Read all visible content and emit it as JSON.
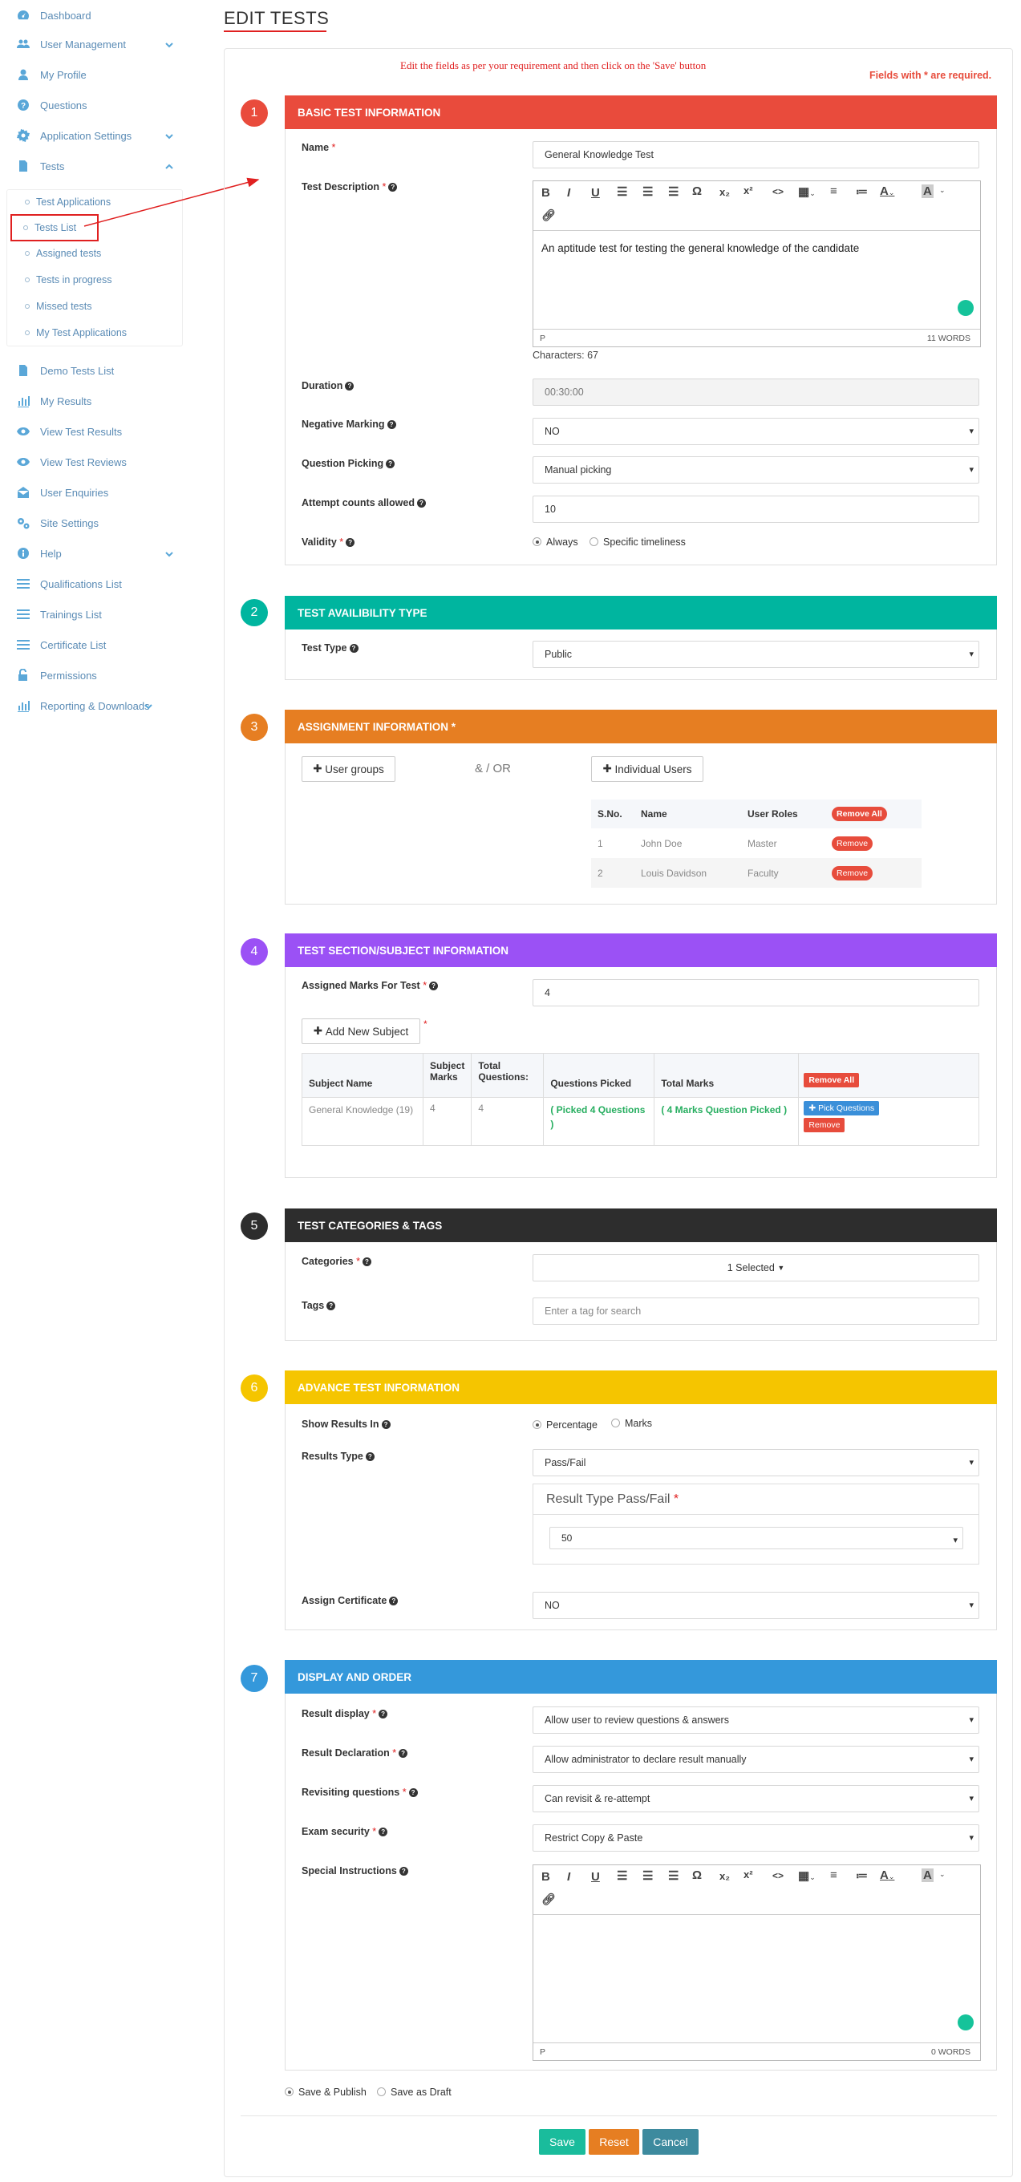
{
  "sidebar": {
    "items": [
      {
        "label": "Dashboard",
        "icon": "dashboard-icon"
      },
      {
        "label": "User Management",
        "icon": "users-icon"
      },
      {
        "label": "My Profile",
        "icon": "user-icon"
      },
      {
        "label": "Questions",
        "icon": "question-icon"
      },
      {
        "label": "Application Settings",
        "icon": "gear-icon"
      },
      {
        "label": "Tests",
        "icon": "file-icon"
      },
      {
        "label": "Demo Tests List",
        "icon": "file-icon"
      },
      {
        "label": "My Results",
        "icon": "bar-chart-icon"
      },
      {
        "label": "View Test Results",
        "icon": "eye-icon"
      },
      {
        "label": "View Test Reviews",
        "icon": "eye-icon"
      },
      {
        "label": "User Enquiries",
        "icon": "envelope-icon"
      },
      {
        "label": "Site Settings",
        "icon": "gears-icon"
      },
      {
        "label": "Help",
        "icon": "info-icon"
      },
      {
        "label": "Qualifications List",
        "icon": "list-icon"
      },
      {
        "label": "Trainings List",
        "icon": "list-icon"
      },
      {
        "label": "Certificate List",
        "icon": "list-icon"
      },
      {
        "label": "Permissions",
        "icon": "unlock-icon"
      },
      {
        "label": "Reporting & Downloads",
        "icon": "bar-chart-icon"
      }
    ],
    "sub_items": [
      "Test Applications",
      "Tests List",
      "Assigned tests",
      "Tests in progress",
      "Missed tests",
      "My Test Applications"
    ]
  },
  "page": {
    "title": "EDIT TESTS",
    "instruction": "Edit the fields as per your requirement and then click on the 'Save' button",
    "required_note": "Fields with * are required."
  },
  "s1": {
    "num": "1",
    "title": "BASIC TEST INFORMATION",
    "name_label": "Name",
    "name_value": "General Knowledge Test",
    "desc_label": "Test Description",
    "desc_text": "An aptitude test for testing the general knowledge of the candidate",
    "editor_path": "P",
    "word_count": "11 WORDS",
    "char_count": "Characters: 67",
    "duration_label": "Duration",
    "duration_value": "00:30:00",
    "neg_label": "Negative Marking",
    "neg_value": "NO",
    "pick_label": "Question Picking",
    "pick_value": "Manual picking",
    "attempt_label": "Attempt counts allowed",
    "attempt_value": "10",
    "validity_label": "Validity",
    "validity_opt1": "Always",
    "validity_opt2": "Specific timeliness"
  },
  "s2": {
    "num": "2",
    "title": "TEST AVAILIBILITY TYPE",
    "type_label": "Test Type",
    "type_value": "Public"
  },
  "s3": {
    "num": "3",
    "title": "ASSIGNMENT INFORMATION *",
    "user_groups": "User groups",
    "and_or": "& / OR",
    "individual": "Individual Users",
    "headers": [
      "S.No.",
      "Name",
      "User Roles"
    ],
    "remove_all": "Remove All",
    "remove": "Remove",
    "rows": [
      {
        "sno": "1",
        "name": "John Doe",
        "role": "Master"
      },
      {
        "sno": "2",
        "name": "Louis Davidson",
        "role": "Faculty"
      }
    ]
  },
  "s4": {
    "num": "4",
    "title": "TEST SECTION/SUBJECT INFORMATION",
    "marks_label": "Assigned Marks For Test",
    "marks_value": "4",
    "add_subject": "Add New Subject",
    "headers": [
      "Subject Name",
      "Subject Marks",
      "Total Questions:",
      "Questions Picked",
      "Total Marks"
    ],
    "remove_all": "Remove All",
    "row": {
      "name": "General Knowledge (19)",
      "marks": "4",
      "total": "4",
      "picked": "( Picked 4 Questions )",
      "total_marks": "( 4 Marks Question Picked )"
    },
    "pick_btn": "Pick Questions",
    "remove_btn": "Remove"
  },
  "s5": {
    "num": "5",
    "title": "TEST CATEGORIES & TAGS",
    "cat_label": "Categories",
    "cat_value": "1 Selected",
    "tags_label": "Tags",
    "tags_placeholder": "Enter a tag for search"
  },
  "s6": {
    "num": "6",
    "title": "ADVANCE TEST INFORMATION",
    "show_label": "Show Results In",
    "opt1": "Percentage",
    "opt2": "Marks",
    "rtype_label": "Results Type",
    "rtype_value": "Pass/Fail",
    "sub_title": "Result Type Pass/Fail",
    "sub_value": "50",
    "cert_label": "Assign Certificate",
    "cert_value": "NO"
  },
  "s7": {
    "num": "7",
    "title": "DISPLAY AND ORDER",
    "display_label": "Result display",
    "display_value": "Allow user to review questions & answers",
    "decl_label": "Result Declaration",
    "decl_value": "Allow administrator to declare result manually",
    "revisit_label": "Revisiting questions",
    "revisit_value": "Can revisit & re-attempt",
    "security_label": "Exam security",
    "security_value": "Restrict Copy & Paste",
    "special_label": "Special Instructions",
    "editor_path": "P",
    "word_count": "0 WORDS"
  },
  "footer": {
    "publish": "Save & Publish",
    "draft": "Save as Draft",
    "save": "Save",
    "reset": "Reset",
    "cancel": "Cancel"
  },
  "colors": {
    "s1": "#e94b3c",
    "s2": "#00b59f",
    "s3": "#e67e22",
    "s4": "#9b51f5",
    "s5": "#2d2d2d",
    "s6": "#f5c500",
    "s7": "#3498db"
  }
}
